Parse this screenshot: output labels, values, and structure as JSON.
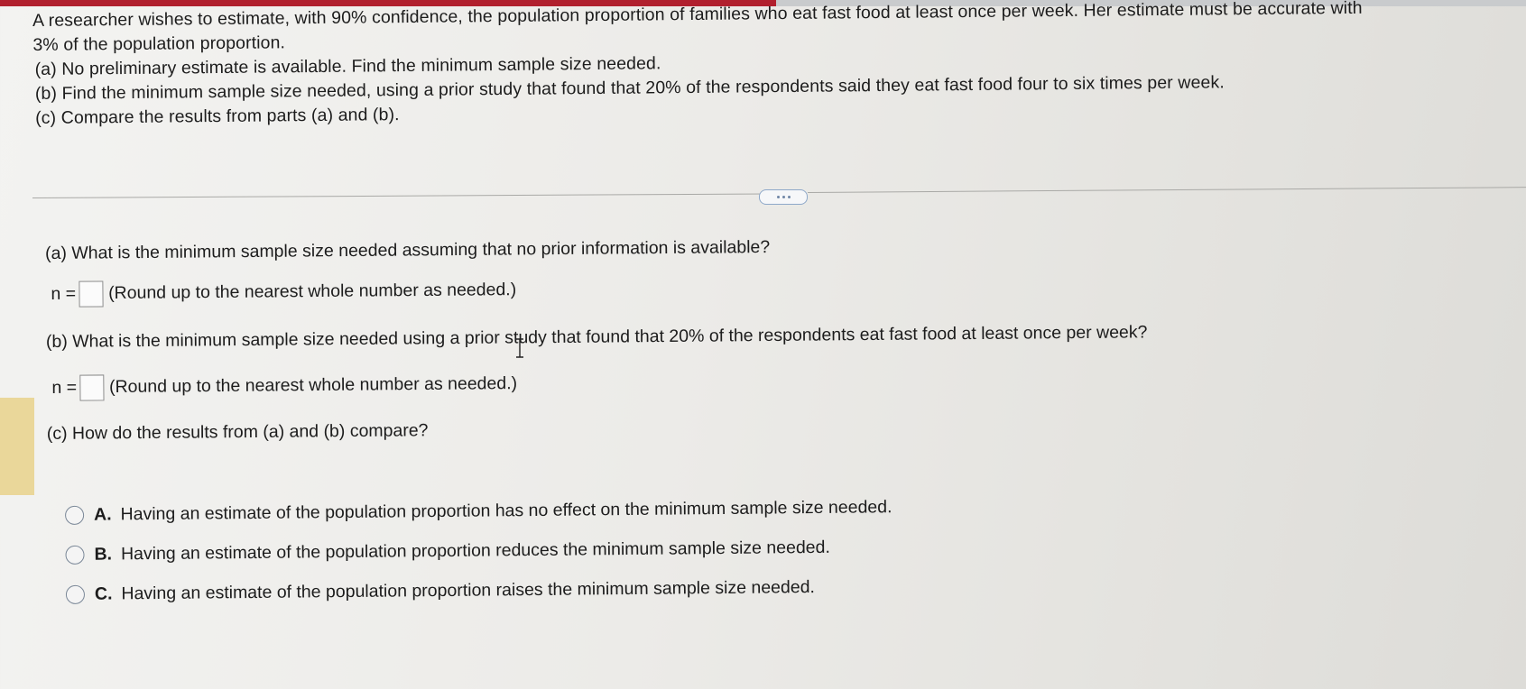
{
  "problem": {
    "intro_line1": "A researcher wishes to estimate, with 90% confidence, the population proportion of families who eat fast food at least once per week. Her estimate must be accurate with",
    "intro_line2": "3% of the population proportion.",
    "part_a": "(a) No preliminary estimate is available. Find the minimum sample size needed.",
    "part_b": "(b) Find the minimum sample size needed, using a prior study that found that 20% of the respondents said they eat fast food four to six times per week.",
    "part_c": "(c) Compare the results from parts (a) and (b)."
  },
  "questions": {
    "a_prompt": "(a) What is the minimum sample size needed assuming that no prior information is available?",
    "a_label": "n =",
    "a_value": "",
    "a_hint": "(Round up to the nearest whole number as needed.)",
    "b_prompt": "(b) What is the minimum sample size needed using a prior study that found that 20% of the respondents eat fast food at least once per week?",
    "b_label": "n =",
    "b_value": "",
    "b_hint": "(Round up to the nearest whole number as needed.)",
    "c_prompt": "(c) How do the results from (a) and (b) compare?"
  },
  "choices": [
    {
      "letter": "A.",
      "text": "Having an estimate of the population proportion has no effect on the minimum sample size needed."
    },
    {
      "letter": "B.",
      "text": "Having an estimate of the population proportion reduces the minimum sample size needed."
    },
    {
      "letter": "C.",
      "text": "Having an estimate of the population proportion raises the minimum sample size needed."
    }
  ],
  "colors": {
    "accent_bar": "#b1202e",
    "marker": "#ead79a",
    "radio_border": "#7a8797"
  },
  "icons": {
    "more": "ellipsis-icon",
    "cursor": "text-cursor-icon"
  }
}
